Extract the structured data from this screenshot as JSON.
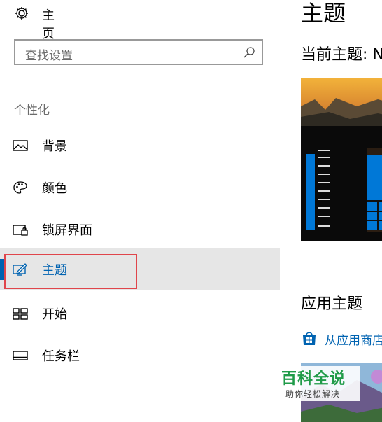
{
  "sidebar": {
    "home": {
      "label": "主页",
      "icon": "gear-icon"
    },
    "search": {
      "placeholder": "查找设置",
      "icon": "search-icon"
    },
    "group_label": "个性化",
    "items": [
      {
        "label": "背景",
        "icon": "picture-icon"
      },
      {
        "label": "颜色",
        "icon": "palette-icon"
      },
      {
        "label": "锁屏界面",
        "icon": "lock-screen-icon"
      },
      {
        "label": "主题",
        "icon": "theme-brush-icon",
        "selected": true
      },
      {
        "label": "开始",
        "icon": "start-tiles-icon"
      },
      {
        "label": "任务栏",
        "icon": "taskbar-icon"
      }
    ]
  },
  "main": {
    "title": "主题",
    "current_theme_label": "当前主题: N",
    "apply_title": "应用主题",
    "store_link": {
      "label": "从应用商店",
      "icon": "store-bag-icon"
    }
  },
  "watermark": {
    "title": "百科全说",
    "subtitle": "助你轻松解决"
  },
  "colors": {
    "accent": "#0063b1",
    "selected_bg": "#e6e6e6",
    "highlight_border": "#e0454b",
    "watermark_green": "#1f9b48"
  }
}
